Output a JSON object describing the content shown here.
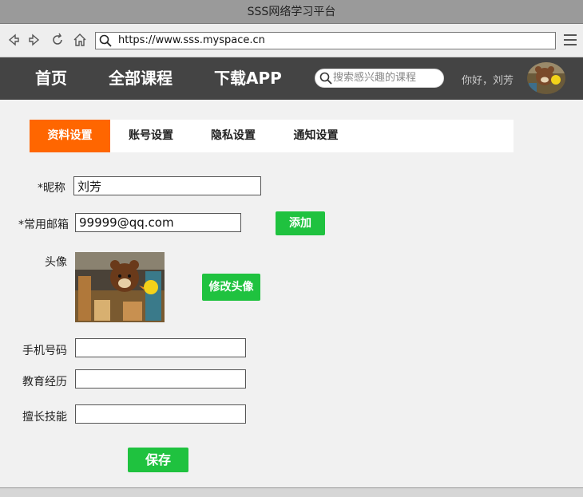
{
  "window": {
    "title": "SSS网络学习平台"
  },
  "browser": {
    "url": "https://www.sss.myspace.cn"
  },
  "nav": {
    "links": [
      "首页",
      "全部课程",
      "下载APP"
    ],
    "search_placeholder": "搜索感兴趣的课程",
    "greeting": "你好，刘芳"
  },
  "tabs": [
    {
      "label": "资料设置",
      "active": true
    },
    {
      "label": "账号设置",
      "active": false
    },
    {
      "label": "隐私设置",
      "active": false
    },
    {
      "label": "通知设置",
      "active": false
    }
  ],
  "form": {
    "nickname": {
      "label": "*昵称",
      "value": "刘芳"
    },
    "email": {
      "label": "*常用邮箱",
      "value": "99999@qq.com",
      "button": "添加"
    },
    "avatar": {
      "label": "头像",
      "button": "修改头像"
    },
    "phone": {
      "label": "手机号码",
      "value": ""
    },
    "education": {
      "label": "教育经历",
      "value": ""
    },
    "skills": {
      "label": "擅长技能",
      "value": ""
    },
    "save_button": "保存"
  },
  "colors": {
    "accent_tab": "#ff6600",
    "button_green": "#1fc23f",
    "nav_bg": "#444444"
  }
}
